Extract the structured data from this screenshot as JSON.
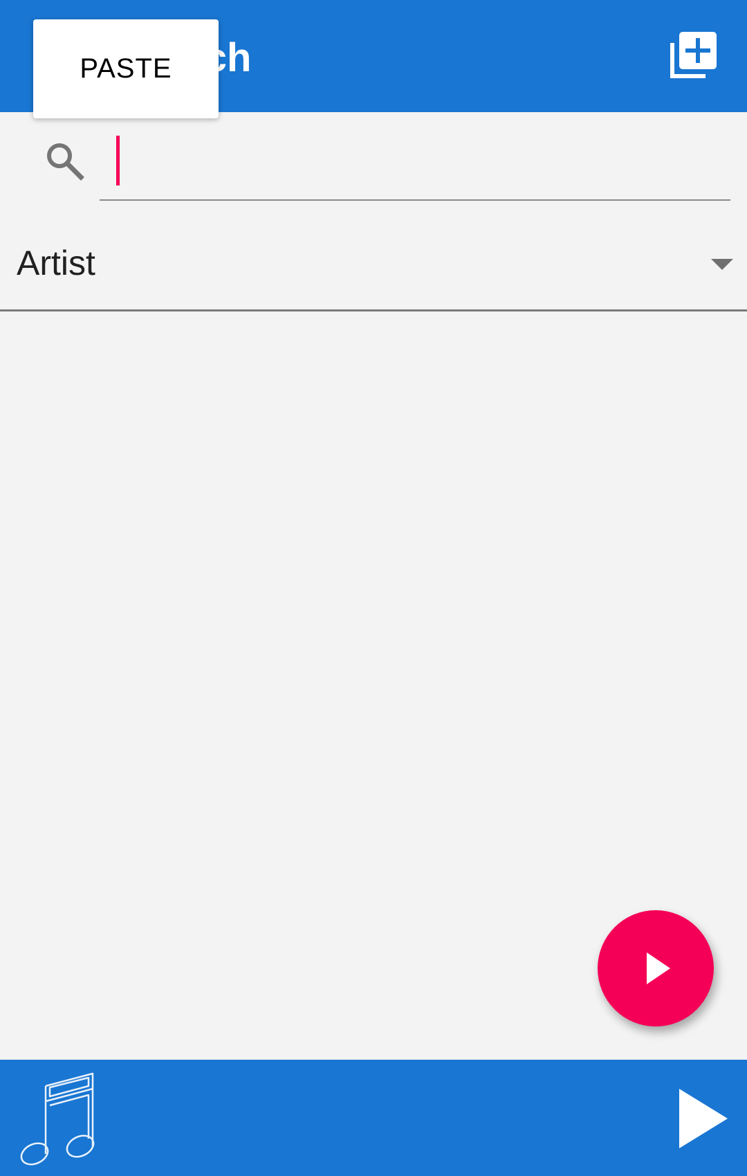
{
  "app_bar": {
    "title": "Search",
    "add_to_queue_icon": "library-add-icon"
  },
  "context_menu": {
    "paste_label": "PASTE"
  },
  "search": {
    "icon": "search-icon",
    "value": "",
    "placeholder": ""
  },
  "filter": {
    "selected": "Artist",
    "icon": "dropdown-arrow-icon"
  },
  "fab": {
    "icon": "play-icon"
  },
  "bottom_bar": {
    "art_icon": "music-note-icon",
    "play_icon": "play-icon"
  },
  "colors": {
    "primary": "#1976d2",
    "accent": "#f50057",
    "background": "#f3f3f3"
  }
}
